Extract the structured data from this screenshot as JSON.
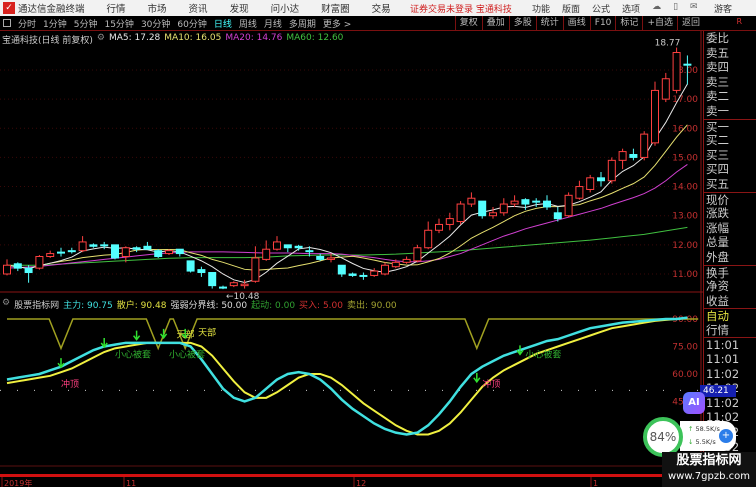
{
  "app": {
    "title": "通达信金融终端",
    "menus": [
      "行情",
      "市场",
      "资讯",
      "发现",
      "问小达",
      "财富圈",
      "交易"
    ],
    "login_status": "证券交易未登录",
    "stock_name_top": "宝通科技",
    "sys_menus": [
      "功能",
      "版面",
      "公式",
      "选项"
    ],
    "user": "游客"
  },
  "toolbar": {
    "periods": [
      "分时",
      "1分钟",
      "5分钟",
      "15分钟",
      "30分钟",
      "60分钟",
      "日线",
      "周线",
      "月线",
      "多周期",
      "更多 >"
    ],
    "active_period": "日线",
    "right": [
      "复权",
      "叠加",
      "多股",
      "统计",
      "画线",
      "F10",
      "标记",
      "+自选",
      "返回"
    ],
    "r_logo": "R"
  },
  "main": {
    "title": "宝通科技(日线 前复权)",
    "ma": [
      {
        "label": "MA5: 17.28",
        "color": "#e8e8e8"
      },
      {
        "label": "MA10: 16.05",
        "color": "#e6e070"
      },
      {
        "label": "MA20: 14.76",
        "color": "#d040d0"
      },
      {
        "label": "MA60: 12.60",
        "color": "#40c040"
      }
    ],
    "high_marker": "18.77",
    "low_marker": "←10.48",
    "price_ticks": [
      "18.00",
      "17.00",
      "16.00",
      "15.00",
      "14.00",
      "13.00",
      "12.00",
      "11.00"
    ]
  },
  "indicator": {
    "name": "股票指标网",
    "fields": [
      {
        "label": "主力: 90.75",
        "color": "#40e0e0"
      },
      {
        "label": "散户: 90.48",
        "color": "#e0e040"
      },
      {
        "label": "强弱分界线: 50.00",
        "color": "#dddddd"
      },
      {
        "label": "起动: 0.00",
        "color": "#30a030"
      },
      {
        "label": "买入: 5.00",
        "color": "#d03030"
      },
      {
        "label": "卖出: 90.00",
        "color": "#a0a030"
      }
    ],
    "ticks": [
      "90.00",
      "75.00",
      "60.00",
      "45.00"
    ],
    "cursor_value": "46.21",
    "labels": [
      {
        "text": "冲顶",
        "i": 5,
        "v": 53,
        "color": "#ff4080"
      },
      {
        "text": "冲顶",
        "i": 44,
        "v": 53,
        "color": "#ff4080"
      },
      {
        "text": "小心被套",
        "i": 10,
        "v": 69,
        "color": "#30b030"
      },
      {
        "text": "小心被套",
        "i": 15,
        "v": 69,
        "color": "#30b030"
      },
      {
        "text": "小心被套",
        "i": 48,
        "v": 69,
        "color": "#30b030"
      },
      {
        "text": "天部",
        "i": 15.7,
        "v": 80,
        "color": "#e0e040"
      },
      {
        "text": "天部",
        "i": 17.7,
        "v": 81,
        "color": "#e0e040"
      }
    ],
    "arrows": [
      5,
      9,
      12,
      14.5,
      16.5,
      43.5,
      47.5
    ]
  },
  "time_axis": [
    "2019年",
    "11",
    "12",
    "1"
  ],
  "right_panel": [
    "委比",
    "卖五",
    "卖四",
    "卖三",
    "卖二",
    "卖一",
    "买一",
    "买二",
    "买三",
    "买四",
    "买五",
    "现价",
    "涨跌",
    "涨幅",
    "总量",
    "外盘",
    "换手",
    "净资",
    "收益",
    "自动",
    "行情",
    "11:01",
    "11:01",
    "11:02",
    "11:02",
    "11:02",
    "11:02",
    "11:02",
    "11:02",
    "11:02"
  ],
  "overlay": {
    "ai": "AI",
    "cpu": "84%",
    "upload": "58.5K/s",
    "download": "5.5K/s",
    "watermark_title": "股票指标网",
    "watermark_url": "www.7gpzb.com"
  },
  "chart_data": {
    "type": "candlestick",
    "yrange": [
      10.2,
      19.0
    ],
    "ohlc": [
      [
        11.0,
        11.3,
        11.5,
        10.95
      ],
      [
        11.35,
        11.2,
        11.4,
        11.1
      ],
      [
        11.2,
        11.05,
        11.3,
        10.7
      ],
      [
        11.2,
        11.6,
        11.65,
        11.15
      ],
      [
        11.6,
        11.7,
        11.8,
        11.55
      ],
      [
        11.75,
        11.75,
        11.9,
        11.6
      ],
      [
        11.8,
        11.8,
        11.9,
        11.7
      ],
      [
        11.8,
        12.1,
        12.3,
        11.75
      ],
      [
        12.0,
        11.95,
        12.05,
        11.9
      ],
      [
        12.0,
        12.0,
        12.1,
        11.85
      ],
      [
        12.0,
        11.55,
        12.0,
        11.5
      ],
      [
        11.6,
        11.9,
        11.95,
        11.4
      ],
      [
        11.9,
        11.85,
        11.95,
        11.75
      ],
      [
        11.95,
        11.85,
        12.1,
        11.85
      ],
      [
        11.8,
        11.6,
        11.85,
        11.55
      ],
      [
        11.7,
        11.8,
        11.85,
        11.65
      ],
      [
        11.85,
        11.7,
        11.85,
        11.6
      ],
      [
        11.45,
        11.1,
        11.45,
        11.05
      ],
      [
        11.15,
        11.05,
        11.25,
        10.9
      ],
      [
        11.05,
        10.6,
        11.05,
        10.5
      ],
      [
        10.55,
        10.55,
        10.6,
        10.48
      ],
      [
        10.6,
        10.7,
        10.75,
        10.55
      ],
      [
        10.6,
        10.65,
        10.8,
        10.5
      ],
      [
        10.75,
        11.55,
        11.95,
        10.7
      ],
      [
        11.5,
        11.85,
        12.15,
        11.45
      ],
      [
        11.85,
        12.1,
        12.3,
        11.8
      ],
      [
        12.0,
        11.9,
        12.0,
        11.75
      ],
      [
        11.95,
        11.9,
        12.0,
        11.8
      ],
      [
        11.8,
        11.8,
        11.95,
        11.6
      ],
      [
        11.6,
        11.5,
        11.7,
        11.45
      ],
      [
        11.5,
        11.55,
        11.7,
        11.4
      ],
      [
        11.3,
        11.0,
        11.3,
        10.9
      ],
      [
        11.0,
        10.95,
        11.05,
        10.9
      ],
      [
        10.95,
        10.95,
        11.05,
        10.8
      ],
      [
        10.95,
        11.1,
        11.2,
        10.9
      ],
      [
        11.0,
        11.3,
        11.4,
        10.95
      ],
      [
        11.25,
        11.4,
        11.5,
        11.2
      ],
      [
        11.4,
        11.5,
        11.6,
        11.35
      ],
      [
        11.45,
        11.9,
        12.0,
        11.4
      ],
      [
        11.9,
        12.5,
        12.8,
        11.85
      ],
      [
        12.5,
        12.7,
        12.9,
        12.4
      ],
      [
        12.7,
        12.9,
        13.1,
        12.5
      ],
      [
        12.8,
        13.4,
        13.5,
        12.7
      ],
      [
        13.4,
        13.6,
        13.8,
        13.3
      ],
      [
        13.5,
        13.0,
        13.5,
        12.9
      ],
      [
        13.0,
        13.1,
        13.3,
        12.9
      ],
      [
        13.1,
        13.4,
        13.6,
        13.0
      ],
      [
        13.4,
        13.5,
        13.7,
        13.3
      ],
      [
        13.55,
        13.4,
        13.6,
        13.2
      ],
      [
        13.5,
        13.5,
        13.6,
        13.3
      ],
      [
        13.5,
        13.3,
        13.7,
        13.2
      ],
      [
        13.1,
        12.9,
        13.3,
        12.8
      ],
      [
        13.0,
        13.7,
        13.8,
        12.95
      ],
      [
        13.6,
        14.0,
        14.2,
        13.55
      ],
      [
        13.9,
        14.3,
        14.4,
        13.8
      ],
      [
        14.3,
        14.2,
        14.5,
        14.0
      ],
      [
        14.2,
        14.9,
        15.0,
        14.1
      ],
      [
        14.9,
        15.2,
        15.3,
        14.6
      ],
      [
        15.1,
        15.0,
        15.3,
        14.9
      ],
      [
        15.0,
        15.8,
        15.9,
        14.9
      ],
      [
        15.5,
        17.3,
        17.6,
        15.4
      ],
      [
        17.0,
        17.7,
        17.9,
        16.9
      ],
      [
        17.3,
        18.6,
        18.77,
        17.2
      ],
      [
        18.2,
        18.2,
        18.5,
        17.5
      ]
    ],
    "ma60": [
      11.3,
      11.3,
      11.3,
      11.3,
      11.32,
      11.34,
      11.36,
      11.38,
      11.4,
      11.42,
      11.44,
      11.46,
      11.48,
      11.5,
      11.52,
      11.54,
      11.55,
      11.56,
      11.56,
      11.56,
      11.56,
      11.56,
      11.56,
      11.57,
      11.58,
      11.6,
      11.62,
      11.63,
      11.64,
      11.65,
      11.65,
      11.65,
      11.65,
      11.65,
      11.66,
      11.67,
      11.68,
      11.7,
      11.72,
      11.74,
      11.76,
      11.78,
      11.8,
      11.83,
      11.86,
      11.89,
      11.92,
      11.95,
      11.98,
      12.01,
      12.04,
      12.07,
      12.1,
      12.13,
      12.16,
      12.2,
      12.24,
      12.28,
      12.32,
      12.36,
      12.42,
      12.48,
      12.54,
      12.6
    ],
    "ma20": [
      11.2,
      11.22,
      11.24,
      11.26,
      11.3,
      11.34,
      11.38,
      11.42,
      11.46,
      11.5,
      11.54,
      11.58,
      11.62,
      11.66,
      11.7,
      11.72,
      11.74,
      11.76,
      11.76,
      11.76,
      11.76,
      11.75,
      11.74,
      11.73,
      11.72,
      11.72,
      11.72,
      11.71,
      11.7,
      11.7,
      11.7,
      11.68,
      11.64,
      11.6,
      11.56,
      11.5,
      11.45,
      11.42,
      11.42,
      11.45,
      11.5,
      11.6,
      11.7,
      11.85,
      12.0,
      12.15,
      12.3,
      12.42,
      12.55,
      12.65,
      12.75,
      12.85,
      12.95,
      13.05,
      13.15,
      13.25,
      13.38,
      13.5,
      13.62,
      13.76,
      13.95,
      14.2,
      14.5,
      14.76
    ],
    "main_force": [
      57,
      58,
      59,
      60,
      62,
      64,
      67,
      70,
      73,
      75,
      76,
      77,
      77,
      77,
      77,
      77,
      77,
      75,
      68,
      60,
      52,
      47,
      45,
      47,
      52,
      57,
      60,
      61,
      60,
      57,
      52,
      46,
      41,
      37,
      33,
      30,
      28,
      27,
      28,
      32,
      38,
      45,
      53,
      60,
      64,
      67,
      70,
      72,
      74,
      76,
      78,
      79,
      81,
      83,
      85,
      86,
      87,
      88,
      88.5,
      89,
      89.5,
      90,
      90,
      90.75
    ],
    "retail": [
      55,
      56,
      57,
      58,
      59,
      61,
      63,
      66,
      69,
      72,
      74,
      75,
      76,
      77,
      77,
      77,
      77,
      77,
      75,
      70,
      63,
      56,
      50,
      47,
      47,
      50,
      54,
      58,
      60,
      60,
      58,
      54,
      49,
      44,
      40,
      36,
      32,
      29,
      27,
      27,
      29,
      33,
      39,
      46,
      53,
      58,
      62,
      65,
      68,
      71,
      73,
      75,
      77,
      79,
      81,
      83,
      85,
      86,
      87,
      88,
      89,
      89.5,
      90,
      90.48
    ],
    "sell_line": 90,
    "sell_dips": [
      5,
      14,
      16.5,
      43.5
    ],
    "dip_value": 74,
    "threshold": 50,
    "ind_yrange": [
      20,
      95
    ]
  }
}
